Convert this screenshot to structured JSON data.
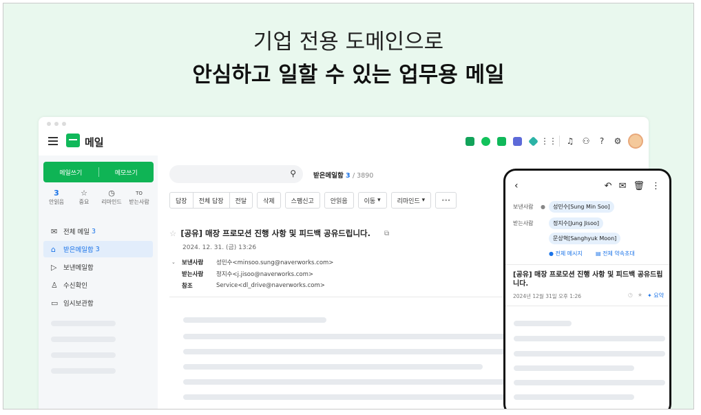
{
  "headline": {
    "line1": "기업 전용 도메인으로",
    "line2": "안심하고 일할 수 있는 업무용 메일"
  },
  "app": {
    "title": "메일"
  },
  "topbar_icons": [
    "green-app-icon",
    "chat-icon",
    "mail-icon",
    "calendar-icon",
    "cube-icon",
    "grid-icon",
    "bell-icon",
    "org-icon",
    "help-icon",
    "settings-icon"
  ],
  "sidebar": {
    "compose": "메일쓰기",
    "memo": "메모쓰기",
    "quick": [
      {
        "value": "3",
        "label": "안읽음"
      },
      {
        "icon": "☆",
        "label": "중요"
      },
      {
        "icon": "◷",
        "label": "리마인드"
      },
      {
        "icon": "TO",
        "label": "받는사람"
      }
    ],
    "items": [
      {
        "icon": "✉",
        "label": "전체 메일",
        "count": "3"
      },
      {
        "icon": "⌂",
        "label": "받은메일함",
        "count": "3"
      },
      {
        "icon": "▷",
        "label": "보낸메일함",
        "count": ""
      },
      {
        "icon": "♙",
        "label": "수신확인",
        "count": ""
      },
      {
        "icon": "▭",
        "label": "임시보관함",
        "count": ""
      }
    ]
  },
  "mailbox": {
    "name": "받은메일함",
    "unread": "3",
    "total": "/ 3890"
  },
  "toolbar": {
    "reply": "답장",
    "reply_all": "전체 답장",
    "forward": "전달",
    "delete": "삭제",
    "spam": "스팸신고",
    "unread": "안읽음",
    "move": "이동",
    "remind": "리마인드",
    "more": "∘∘∘"
  },
  "message": {
    "subject": "[공유] 매장 프로모션 진행 사항 및 피드백 공유드립니다.",
    "date": "2024. 12. 31. (금) 13:26",
    "from_label": "보낸사람",
    "from": "성민수<minsoo.sung@naverworks.com>",
    "to_label": "받는사람",
    "to": "정지수<j.jisoo@naverworks.com>",
    "cc_label": "참조",
    "cc": "Service<dl_drive@naverworks.com>"
  },
  "phone": {
    "from_label": "보낸사람",
    "from": "성민수[Sung Min Soo]",
    "to_label": "받는사람",
    "to1": "정지수[Jung Jisoo]",
    "to2": "문상혁[Sanghyuk Moon]",
    "link1": "전체 메시지",
    "link2": "전체 약속초대",
    "subject": "[공유] 매장 프로모션 진행 사항 및 피드백 공유드립니다.",
    "date": "2024년 12월 31일 오후 1:26",
    "summary": "요약"
  },
  "colors": {
    "accent": "#1a73e8",
    "brand": "#0fb455",
    "background": "#e9f8ee"
  }
}
